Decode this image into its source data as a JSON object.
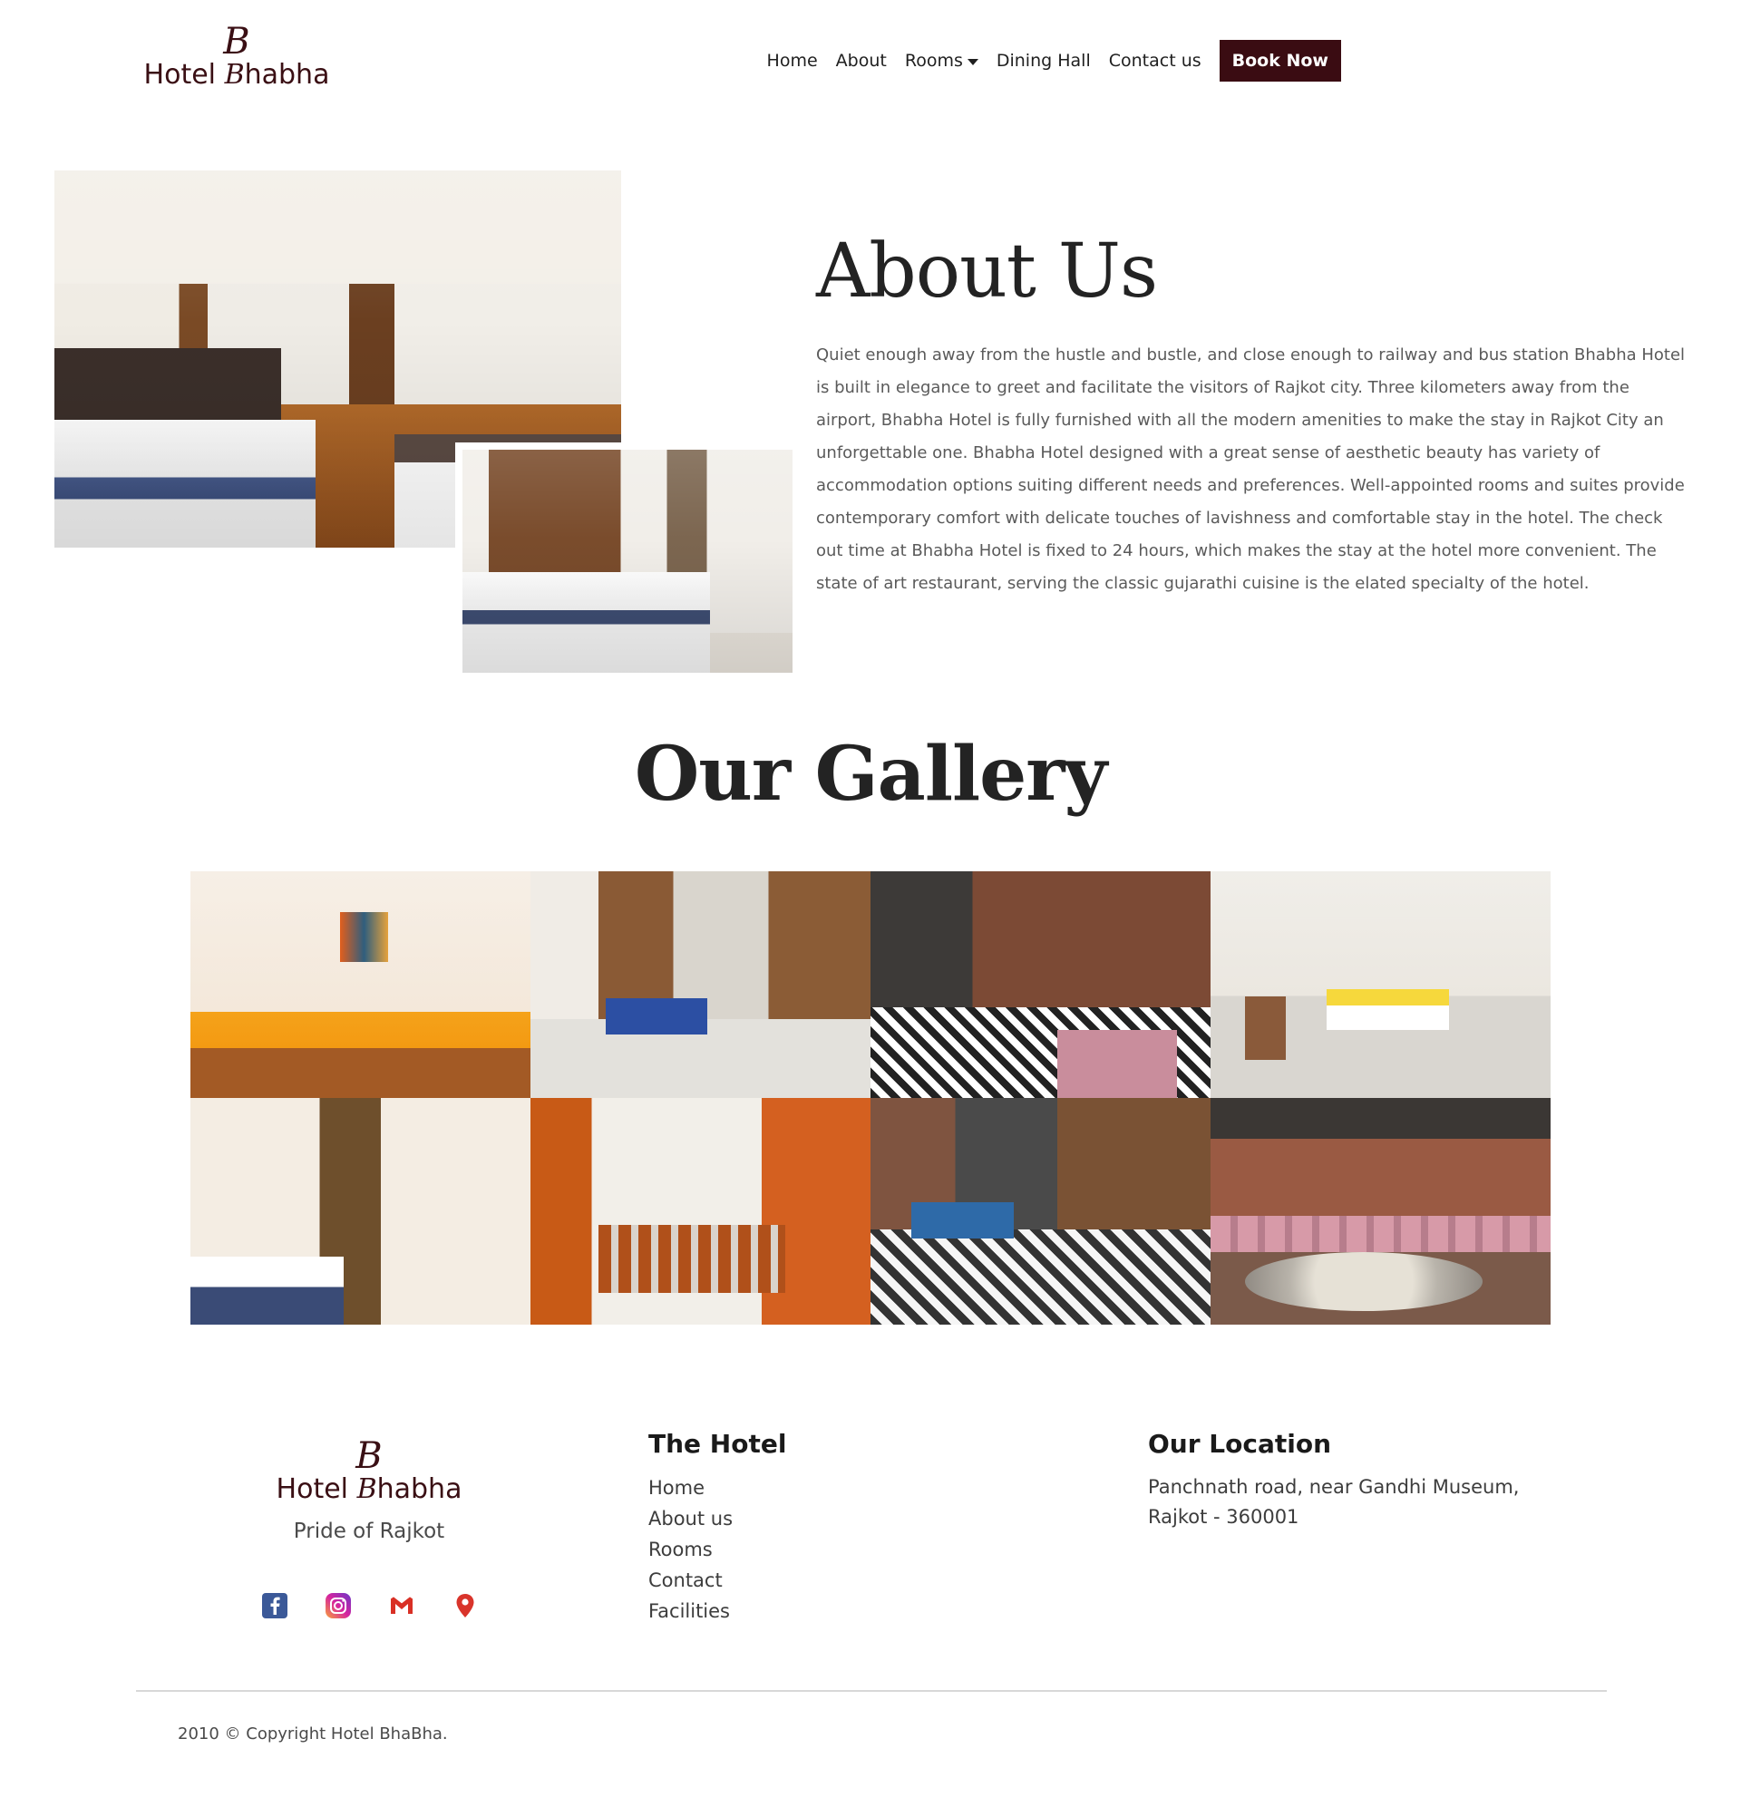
{
  "brand": {
    "monogram": "B",
    "name_prefix": "Hotel ",
    "name_initial": "B",
    "name_rest": "habha"
  },
  "nav": {
    "items": [
      "Home",
      "About",
      "Rooms",
      "Dining Hall",
      "Contact us"
    ],
    "book_label": "Book Now"
  },
  "about": {
    "title": "About Us",
    "text": "Quiet enough away from the hustle and bustle, and close enough to railway and bus station Bhabha Hotel is built in elegance to greet and facilitate the visitors of Rajkot city. Three kilometers away from the airport, Bhabha Hotel is fully furnished with all the modern amenities to make the stay in Rajkot City an unforgettable one. Bhabha Hotel designed with a great sense of aesthetic beauty has variety of accommodation options suiting different needs and preferences. Well-appointed rooms and suites provide contemporary comfort with delicate touches of lavishness and comfortable stay in the hotel. The check out time at Bhabha Hotel is fixed to 24 hours, which makes the stay at the hotel more convenient. The state of art restaurant, serving the classic gujarathi cuisine is the elated specialty of the hotel."
  },
  "gallery": {
    "title": "Our Gallery"
  },
  "footer": {
    "tagline": "Pride of Rajkot",
    "socials": [
      "facebook-icon",
      "instagram-icon",
      "gmail-icon",
      "map-pin-icon"
    ],
    "hotel_title": "The Hotel",
    "hotel_links": [
      "Home",
      "About us",
      "Rooms",
      "Contact",
      "Facilities"
    ],
    "location_title": "Our Location",
    "address": "Panchnath road, near Gandhi Museum, Rajkot - 360001",
    "copyright": "2010 © Copyright Hotel BhaBha."
  },
  "colors": {
    "accent": "#3a0c12",
    "facebook": "#3b5998",
    "instagram": "#c13584",
    "gmail": "#d93025",
    "map": "#d9342b"
  }
}
